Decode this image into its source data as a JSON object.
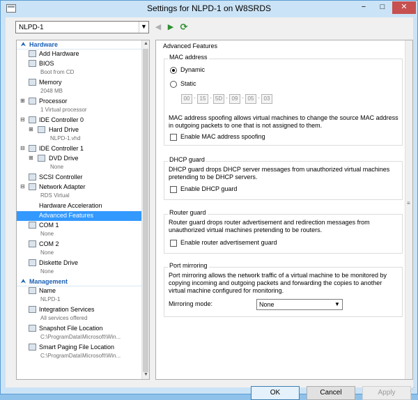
{
  "window": {
    "title": "Settings for NLPD-1 on W8SRDS",
    "buttons": {
      "minimize": "−",
      "maximize": "□",
      "close": "✕"
    }
  },
  "vm_selector": {
    "value": "NLPD-1"
  },
  "toolbar": {
    "back_icon": "◀",
    "forward_icon": "▶",
    "refresh_icon": "⟳"
  },
  "tree": {
    "hardware_label": "Hardware",
    "management_label": "Management",
    "items": [
      {
        "label": "Add Hardware",
        "icon": "add-hardware-icon"
      },
      {
        "label": "BIOS",
        "sub": "Boot from CD",
        "icon": "bios-icon"
      },
      {
        "label": "Memory",
        "sub": "2048 MB",
        "icon": "memory-icon"
      },
      {
        "label": "Processor",
        "sub": "1 Virtual processor",
        "icon": "processor-icon"
      },
      {
        "label": "IDE Controller 0",
        "icon": "ide-controller-icon"
      },
      {
        "label": "Hard Drive",
        "sub": "NLPD-1.vhd",
        "icon": "hard-drive-icon"
      },
      {
        "label": "IDE Controller 1",
        "icon": "ide-controller-icon"
      },
      {
        "label": "DVD Drive",
        "sub": "None",
        "icon": "dvd-drive-icon"
      },
      {
        "label": "SCSI Controller",
        "icon": "scsi-controller-icon"
      },
      {
        "label": "Network Adapter",
        "sub": "RDS Virtual",
        "icon": "network-adapter-icon"
      },
      {
        "label": "Hardware Acceleration"
      },
      {
        "label": "Advanced Features"
      },
      {
        "label": "COM 1",
        "sub": "None",
        "icon": "com-port-icon"
      },
      {
        "label": "COM 2",
        "sub": "None",
        "icon": "com-port-icon"
      },
      {
        "label": "Diskette Drive",
        "sub": "None",
        "icon": "diskette-icon"
      },
      {
        "label": "Name",
        "sub": "NLPD-1",
        "icon": "name-icon"
      },
      {
        "label": "Integration Services",
        "sub": "All services offered",
        "icon": "integration-services-icon"
      },
      {
        "label": "Snapshot File Location",
        "sub": "C:\\ProgramData\\Microsoft\\Win...",
        "icon": "snapshot-icon"
      },
      {
        "label": "Smart Paging File Location",
        "sub": "C:\\ProgramData\\Microsoft\\Win...",
        "icon": "smart-paging-icon"
      }
    ]
  },
  "panel": {
    "title": "Advanced Features",
    "mac": {
      "group_label": "MAC address",
      "dynamic_label": "Dynamic",
      "static_label": "Static",
      "octets": [
        "00",
        "15",
        "5D",
        "09",
        "05",
        "03"
      ],
      "spoof_desc_1": "MAC address spoofing allows virtual machines to change the source MAC address",
      "spoof_desc_2": "in outgoing packets to one that is not assigned to them.",
      "spoof_label": "Enable MAC address spoofing"
    },
    "dhcp": {
      "group_label": "DHCP guard",
      "desc_1": "DHCP guard drops DHCP server messages from unauthorized virtual machines",
      "desc_2": "pretending to be DHCP servers.",
      "checkbox_label": "Enable DHCP guard"
    },
    "router": {
      "group_label": "Router guard",
      "desc_1": "Router guard drops router advertisement and redirection messages from",
      "desc_2": "unauthorized virtual machines pretending to be routers.",
      "checkbox_label": "Enable router advertisement guard"
    },
    "mirroring": {
      "group_label": "Port mirroring",
      "desc_1": "Port mirroring allows the network traffic of a virtual machine to be monitored by",
      "desc_2": "copying incoming and outgoing packets and forwarding the copies to another",
      "desc_3": "virtual machine configured for monitoring.",
      "mode_label": "Mirroring mode:",
      "mode_value": "None"
    }
  },
  "buttons": {
    "ok": "OK",
    "cancel": "Cancel",
    "apply": "Apply"
  }
}
